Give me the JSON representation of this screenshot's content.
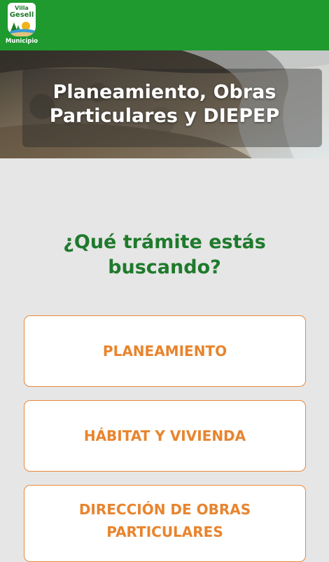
{
  "header": {
    "logo": {
      "line1": "Villa",
      "line2": "Gesell",
      "caption": "Municipio"
    },
    "background_color": "#1e9a2e"
  },
  "hero": {
    "title": "Planeamiento, Obras Particulares y DIEPEP"
  },
  "main": {
    "question": "¿Qué trámite estás buscando?",
    "options": [
      {
        "label": "PLANEAMIENTO"
      },
      {
        "label": "HÁBITAT Y VIVIENDA"
      },
      {
        "label": "DIRECCIÓN DE OBRAS PARTICULARES"
      }
    ]
  },
  "colors": {
    "accent_orange": "#e8842e",
    "heading_green": "#1f7a2c",
    "page_background": "#e6e6e6"
  }
}
